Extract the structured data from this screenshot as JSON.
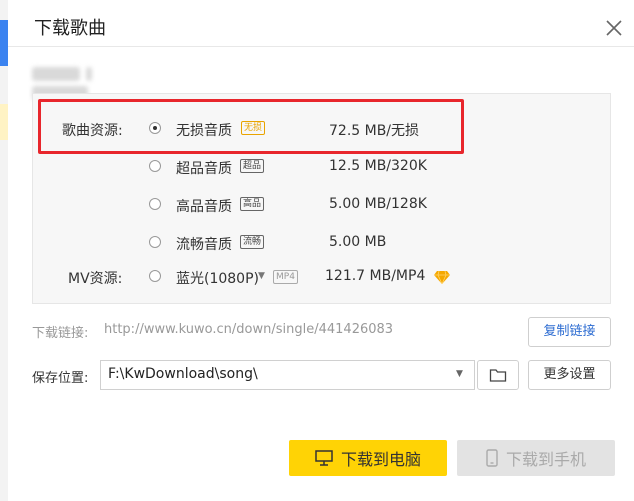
{
  "dialog": {
    "title": "下载歌曲",
    "song_name_blurred": ""
  },
  "sources": {
    "song_label": "歌曲资源:",
    "mv_label": "MV资源:",
    "options": [
      {
        "name": "无损音质",
        "tag": "无损",
        "size": "72.5  MB/无损",
        "selected": true
      },
      {
        "name": "超品音质",
        "tag": "超品",
        "size": "12.5 MB/320K",
        "selected": false
      },
      {
        "name": "高品音质",
        "tag": "高品",
        "size": "5.00 MB/128K",
        "selected": false
      },
      {
        "name": "流畅音质",
        "tag": "流畅",
        "size": "5.00 MB",
        "selected": false
      }
    ],
    "mv": {
      "name": "蓝光(1080P)",
      "tag": "MP4",
      "size": "121.7 MB/MP4",
      "selected": false
    }
  },
  "download_link": {
    "label": "下载链接:",
    "url": "http://www.kuwo.cn/down/single/441426083",
    "copy_button": "复制链接"
  },
  "save_location": {
    "label": "保存位置:",
    "path": "F:\\KwDownload\\song\\",
    "more_settings_button": "更多设置"
  },
  "actions": {
    "download_pc": "下载到电脑",
    "download_phone": "下载到手机"
  },
  "colors": {
    "accent_yellow": "#ffd305",
    "highlight_red": "#e8262c",
    "link_blue": "#2b6bd1",
    "vip_gold": "#f5a800"
  }
}
